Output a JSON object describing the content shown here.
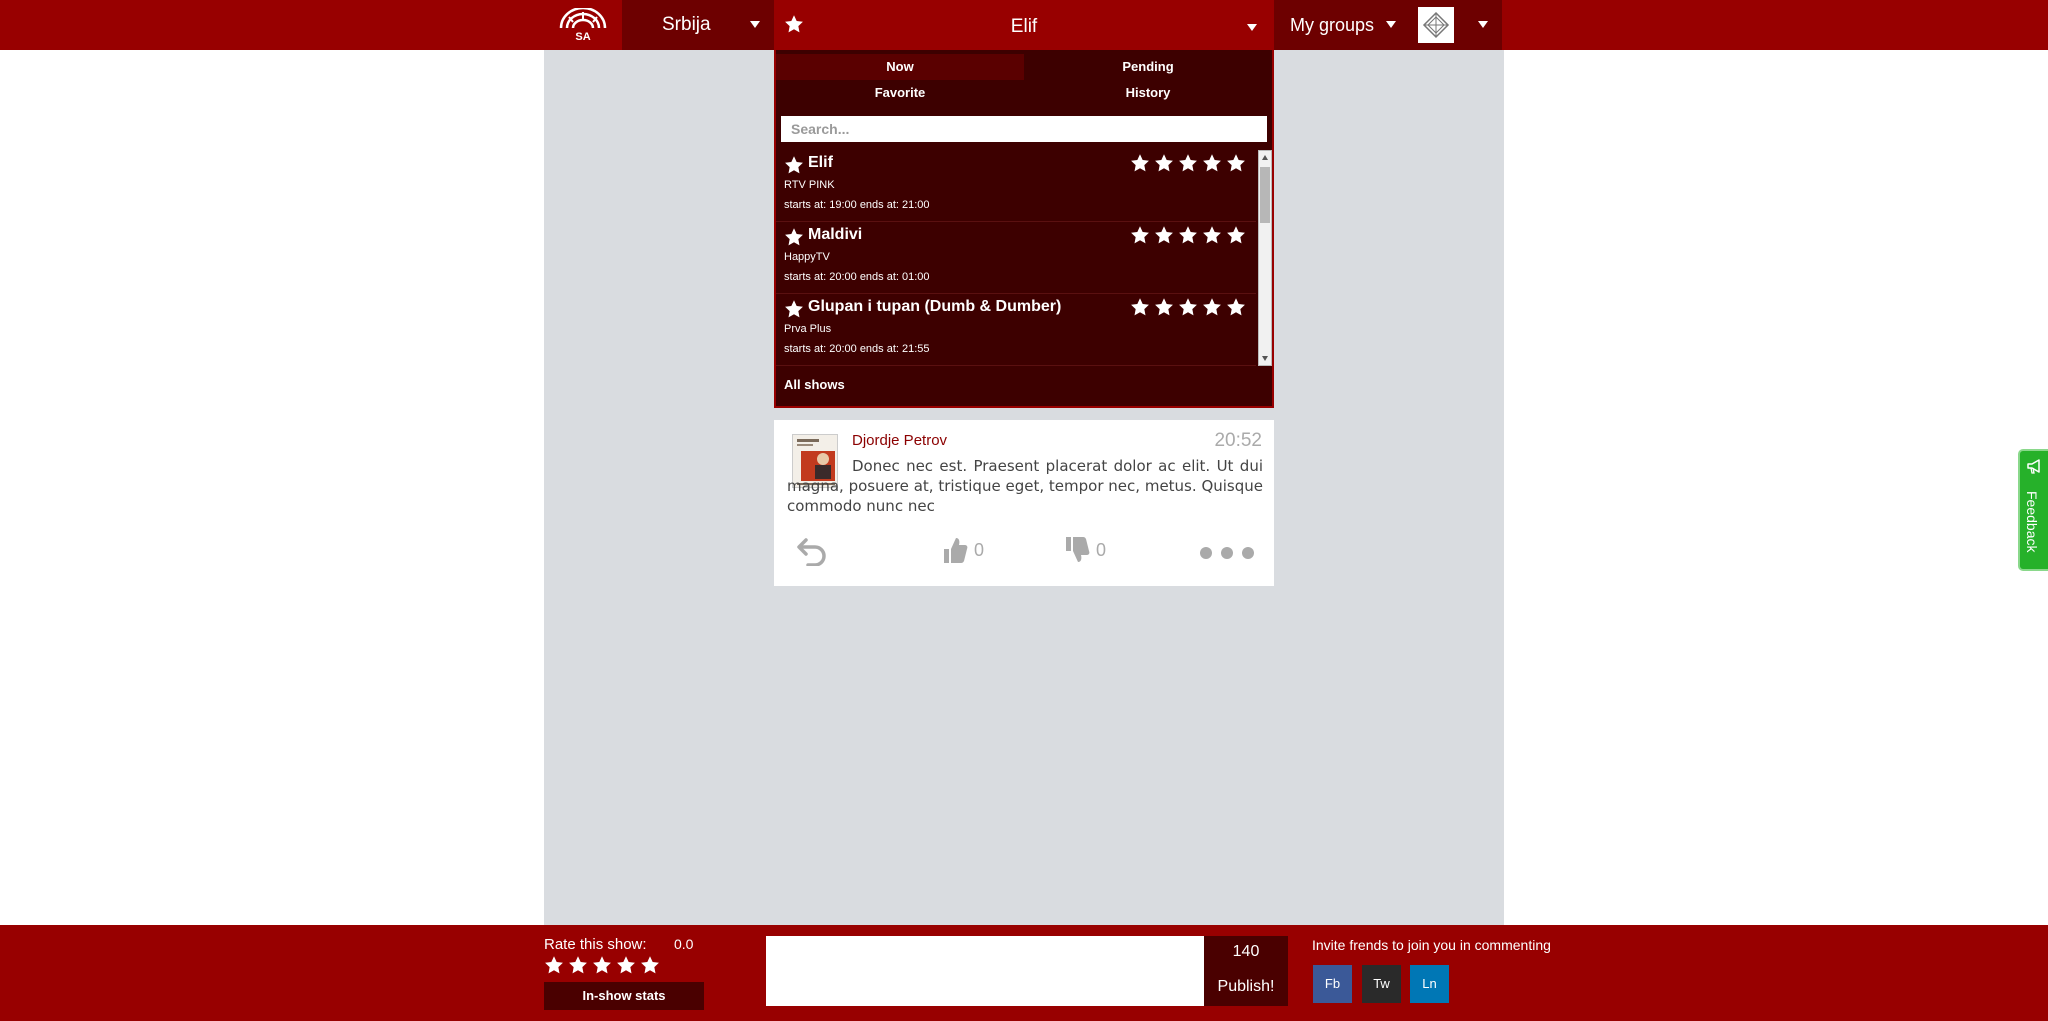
{
  "topbar": {
    "logo_text": "SA",
    "country": "Srbija",
    "current_show": "Elif",
    "groups_label": "My groups"
  },
  "panel": {
    "tabs": [
      {
        "label": "Now"
      },
      {
        "label": "Pending"
      },
      {
        "label": "Favorite"
      },
      {
        "label": "History"
      }
    ],
    "search_placeholder": "Search...",
    "shows": [
      {
        "title": "Elif",
        "channel": "RTV PINK",
        "time": "starts at: 19:00 ends at: 21:00"
      },
      {
        "title": "Maldivi",
        "channel": "HappyTV",
        "time": "starts at: 20:00 ends at: 01:00"
      },
      {
        "title": "Glupan i tupan (Dumb & Dumber)",
        "channel": "Prva Plus",
        "time": "starts at: 20:00 ends at: 21:55"
      }
    ],
    "all_shows_label": "All shows"
  },
  "comment": {
    "author": "Djordje Petrov",
    "time": "20:52",
    "text": "Donec nec est. Praesent placerat dolor ac elit. Ut dui magna, posuere at, tristique eget, tempor nec, metus. Quisque commodo nunc nec",
    "likes": "0",
    "dislikes": "0"
  },
  "bottombar": {
    "rate_label": "Rate this show:",
    "rate_value": "0.0",
    "stats_label": "In-show stats",
    "char_count": "140",
    "publish_label": "Publish!",
    "invite_text": "Invite frends to join you in commenting",
    "social": [
      {
        "label": "Fb",
        "color": "#3b5998"
      },
      {
        "label": "Tw",
        "color": "#2a2a2a"
      },
      {
        "label": "Ln",
        "color": "#0077b5"
      }
    ]
  },
  "feedback_label": "Feedback",
  "colors": {
    "brand": "#980000",
    "brand_dark": "#6d0000",
    "panel_bg": "#3d0000",
    "feedback": "#26b12a"
  },
  "icons": {
    "star": "star-icon",
    "reply": "reply-icon",
    "like": "thumbs-up-icon",
    "dislike": "thumbs-down-icon",
    "more": "more-icon",
    "feedback": "megaphone-icon"
  }
}
